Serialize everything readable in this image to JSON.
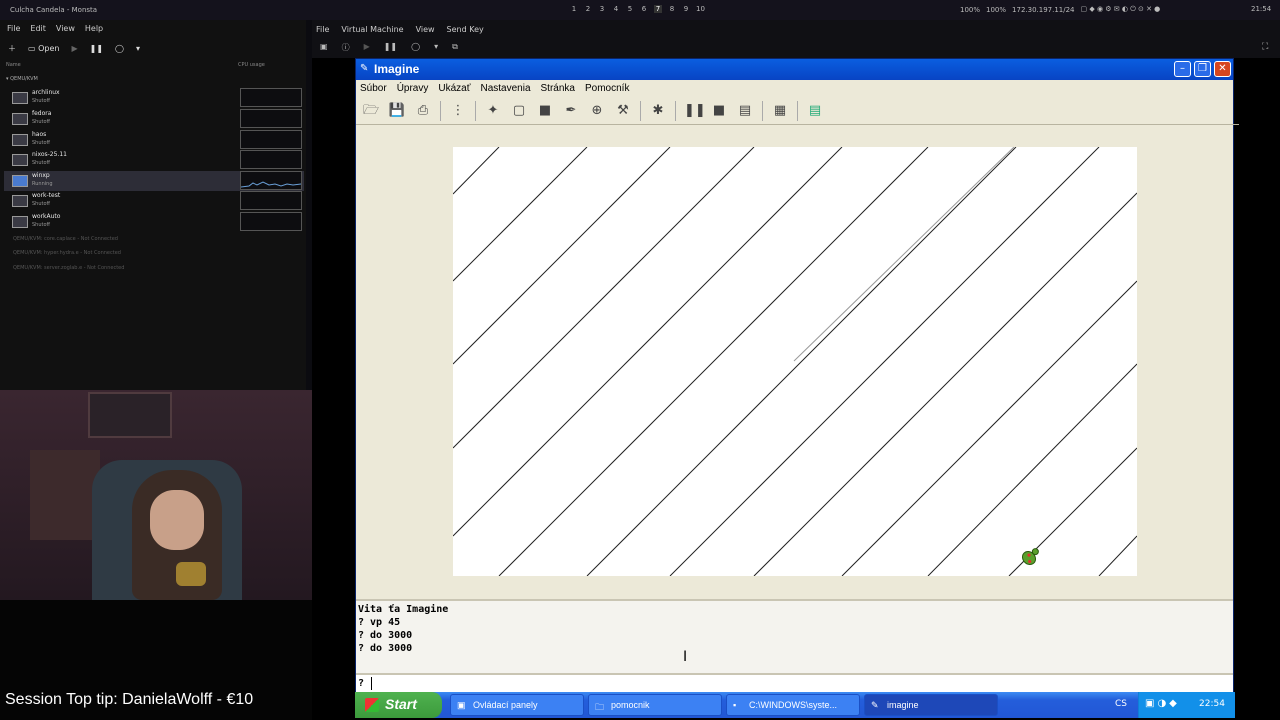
{
  "host": {
    "window_title": "Culcha Candela - Monsta",
    "workspaces": [
      "1",
      "2",
      "3",
      "4",
      "5",
      "6",
      "7",
      "8",
      "9",
      "10"
    ],
    "active_workspace": "7",
    "status": {
      "bat1": "100%",
      "vol": "100%",
      "ip": "172.30.197.11/24"
    },
    "clock": "21:54"
  },
  "virt_manager": {
    "menu": [
      "File",
      "Edit",
      "View",
      "Help"
    ],
    "open_label": "Open",
    "col_name": "Name",
    "col_cpu": "CPU usage",
    "group": "QEMU/KVM",
    "vms": [
      {
        "name": "archlinux",
        "state": "Shutoff"
      },
      {
        "name": "fedora",
        "state": "Shutoff"
      },
      {
        "name": "haos",
        "state": "Shutoff"
      },
      {
        "name": "nixos-25.11",
        "state": "Shutoff"
      },
      {
        "name": "winxp",
        "state": "Running"
      },
      {
        "name": "work-test",
        "state": "Shutoff"
      },
      {
        "name": "workAuto",
        "state": "Shutoff"
      }
    ],
    "connections": [
      "QEMU/KVM: core.caplace - Not Connected",
      "QEMU/KVM: hyper.hydra.e - Not Connected",
      "QEMU/KVM: server.zoglab.e - Not Connected"
    ]
  },
  "stream": {
    "tip": "Session Top tip: DanielaWolff - €10"
  },
  "viewer": {
    "menu": [
      "File",
      "Virtual Machine",
      "View",
      "Send Key"
    ]
  },
  "imagine": {
    "title": "Imagine",
    "menu": [
      "Súbor",
      "Úpravy",
      "Ukázať",
      "Nastavenia",
      "Stránka",
      "Pomocník"
    ],
    "console_lines": [
      "Vita ťa Imagine",
      "? vp 45",
      "? do 3000",
      "? do 3000"
    ],
    "prompt": "?"
  },
  "taskbar": {
    "start": "Start",
    "tasks": [
      {
        "label": "Ovládací panely",
        "icon": "control-panel-icon"
      },
      {
        "label": "pomocnik",
        "icon": "folder-icon"
      },
      {
        "label": "C:\\WINDOWS\\syste...",
        "icon": "cmd-icon"
      },
      {
        "label": "imagine",
        "icon": "imagine-icon"
      }
    ],
    "lang": "CS",
    "clock": "22:54"
  }
}
